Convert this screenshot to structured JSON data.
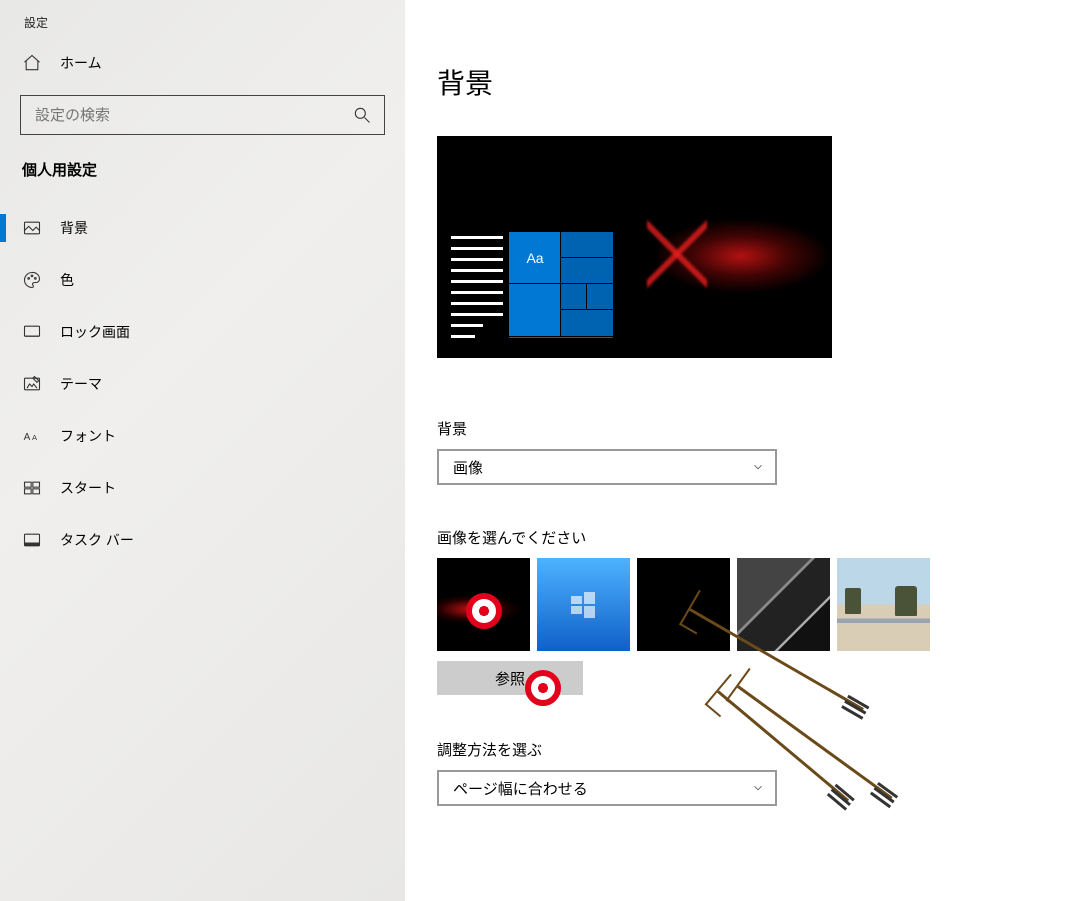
{
  "window": {
    "title": "設定"
  },
  "sidebar": {
    "home": "ホーム",
    "search_placeholder": "設定の検索",
    "section": "個人用設定",
    "items": [
      {
        "label": "背景",
        "selected": true
      },
      {
        "label": "色"
      },
      {
        "label": "ロック画面"
      },
      {
        "label": "テーマ"
      },
      {
        "label": "フォント"
      },
      {
        "label": "スタート"
      },
      {
        "label": "タスク バー"
      }
    ]
  },
  "main": {
    "title": "背景",
    "preview_tile_label": "Aa",
    "bg_type": {
      "label": "背景",
      "value": "画像"
    },
    "choose_image": {
      "label": "画像を選んでください",
      "browse": "参照"
    },
    "fit": {
      "label": "調整方法を選ぶ",
      "value": "ページ幅に合わせる"
    }
  }
}
